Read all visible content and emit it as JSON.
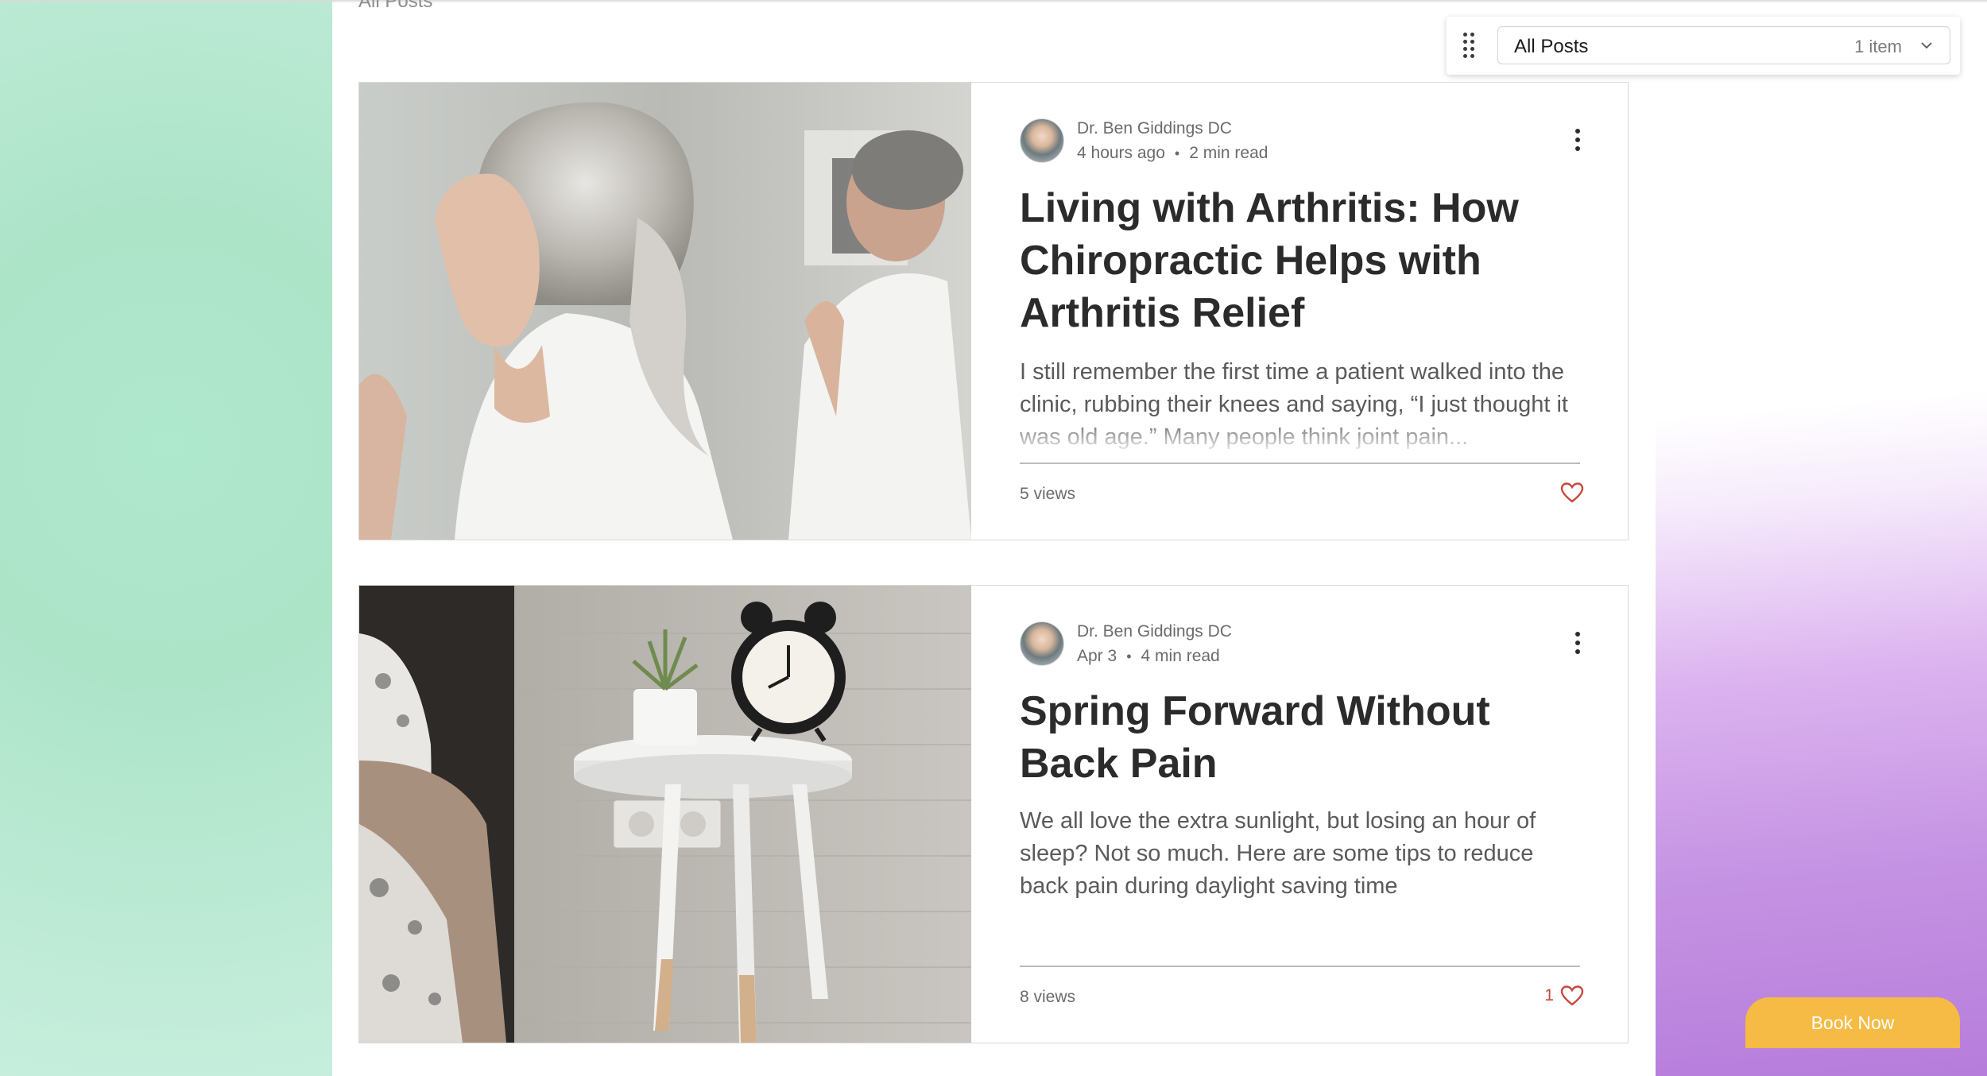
{
  "header": {
    "cut_label": "All Posts"
  },
  "filter": {
    "handle_icon": "drag-handle-icon",
    "selected": "All Posts",
    "count": "1 item",
    "chevron_icon": "chevron-down-icon"
  },
  "posts": [
    {
      "author": "Dr. Ben Giddings DC",
      "time": "4 hours ago",
      "read": "2 min read",
      "title": "Living with Arthritis: How Chiropractic Helps with Arthritis Relief",
      "excerpt": "I still remember the first time a patient walked into the clinic, rubbing their knees and saying, “I just thought it was old age.” Many people think joint pain...",
      "views": "5 views",
      "likes": "",
      "image_desc": "older-woman-yoga"
    },
    {
      "author": "Dr. Ben Giddings DC",
      "time": "Apr 3",
      "read": "4 min read",
      "title": "Spring Forward Without Back Pain",
      "excerpt": "We all love the extra sunlight, but losing an hour of sleep? Not so much. Here are some tips to reduce back pain during daylight saving time",
      "views": "8 views",
      "likes": "1",
      "image_desc": "alarm-clock-nightstand"
    }
  ],
  "book_now": {
    "label": "Book Now"
  },
  "colors": {
    "accent_heart": "#c8483b",
    "book_now_bg": "#f5bb44",
    "left_bg": "#ace4c8",
    "right_bg": "#c593e3"
  }
}
